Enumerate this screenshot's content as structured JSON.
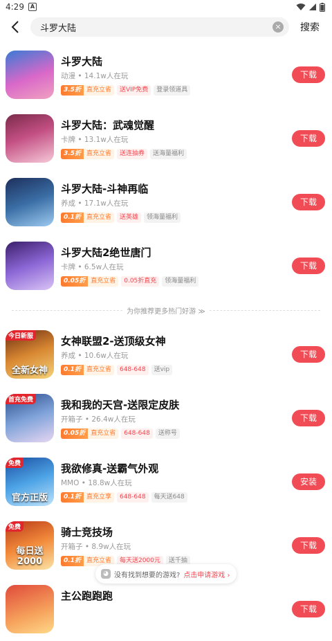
{
  "status": {
    "time": "4:29"
  },
  "search": {
    "value": "斗罗大陆",
    "button": "搜索"
  },
  "games": [
    {
      "title": "斗罗大陆",
      "meta": "动漫 • 14.1w人在玩",
      "disc": "3.5折",
      "disc_label": "直充立省",
      "tag1": "送VIP免费",
      "tag2": "登录领道具",
      "button": "下载",
      "thumb_text": "",
      "corner": ""
    },
    {
      "title": "斗罗大陆：武魂觉醒",
      "meta": "卡牌 • 13.1w人在玩",
      "disc": "3.5折",
      "disc_label": "直充立省",
      "tag1": "送连抽券",
      "tag2": "送海量福利",
      "button": "下载",
      "thumb_text": "",
      "corner": ""
    },
    {
      "title": "斗罗大陆-斗神再临",
      "meta": "养成 • 17.1w人在玩",
      "disc": "0.1折",
      "disc_label": "直充立省",
      "tag1": "送英雄",
      "tag2": "领海量福利",
      "button": "下载",
      "thumb_text": "",
      "corner": ""
    },
    {
      "title": "斗罗大陆2绝世唐门",
      "meta": "卡牌 • 6.5w人在玩",
      "disc": "0.05折",
      "disc_label": "直充立省",
      "tag1": "0.05折直充",
      "tag2": "领海量福利",
      "button": "下载",
      "thumb_text": "",
      "corner": ""
    }
  ],
  "recommend": {
    "label": "为你推荐更多热门好游 ≫"
  },
  "recs": [
    {
      "title": "女神联盟2-送顶级女神",
      "meta": "养成 • 10.6w人在玩",
      "disc": "0.1折",
      "disc_label": "直充立省",
      "tag1": "648-648",
      "tag2": "送vip",
      "button": "下载",
      "thumb_text": "全新女神",
      "corner": "今日新服"
    },
    {
      "title": "我和我的天宫-送限定皮肤",
      "meta": "开箱子 • 26.4w人在玩",
      "disc": "0.05折",
      "disc_label": "直充立省",
      "tag1": "648-648",
      "tag2": "送称号",
      "button": "下载",
      "thumb_text": "",
      "corner": "首充免费"
    },
    {
      "title": "我欲修真-送霸气外观",
      "meta": "MMO • 18.8w人在玩",
      "disc": "0.1折",
      "disc_label": "直充立享",
      "tag1": "648-648",
      "tag2": "每天送648",
      "button": "安装",
      "thumb_text": "官方正版",
      "corner": "免费"
    },
    {
      "title": "骑士竞技场",
      "meta": "开箱子 • 8.9w人在玩",
      "disc": "0.1折",
      "disc_label": "直充立省",
      "tag1": "每天送2000元",
      "tag2": "送千抽",
      "button": "下载",
      "thumb_text": "每日送2000",
      "corner": "免费"
    },
    {
      "title": "主公跑跑跑",
      "meta": "",
      "disc": "",
      "disc_label": "",
      "tag1": "",
      "tag2": "",
      "button": "下载",
      "thumb_text": "",
      "corner": ""
    }
  ],
  "float_tip": {
    "text": "没有找到想要的游戏?",
    "link": "点击申请游戏 ›"
  },
  "colors": {
    "accent": "#f14c55",
    "discount": "#ff7a2e"
  }
}
